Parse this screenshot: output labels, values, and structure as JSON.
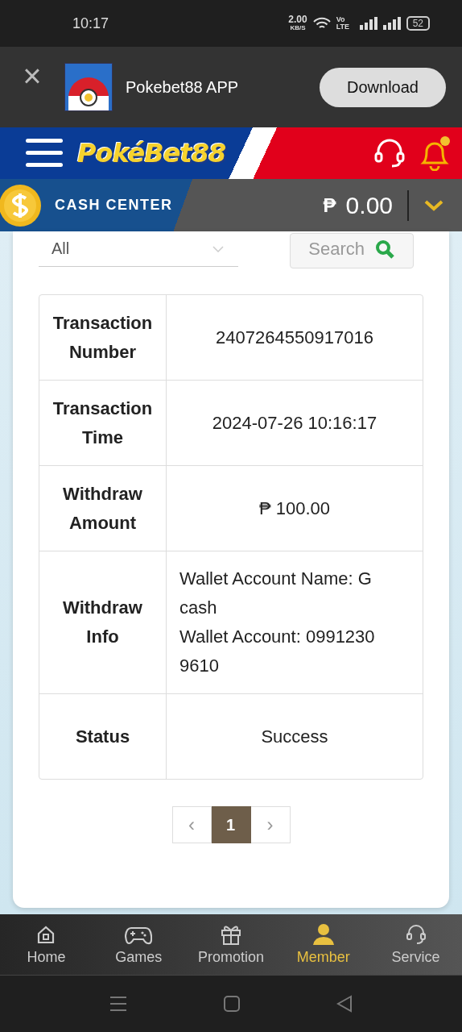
{
  "status_bar": {
    "time": "10:17",
    "speed": "2.00",
    "speed_unit": "KB/S",
    "network": "Vo LTE",
    "battery": "52"
  },
  "app_banner": {
    "close": "×",
    "title": "Pokebet88 APP",
    "button": "Download"
  },
  "header": {
    "logo": "PokéBet88",
    "notification": true
  },
  "cash_center": {
    "label": "CASH CENTER",
    "currency": "₱",
    "balance": "0.00"
  },
  "filter": {
    "value": "All",
    "search_button": "Search"
  },
  "details": [
    {
      "label": "Transaction Number",
      "value": "2407264550917016"
    },
    {
      "label": "Transaction Time",
      "value": "2024-07-26 10:16:17"
    },
    {
      "label": "Withdraw Amount",
      "value": "₱ 100.00"
    },
    {
      "label": "Withdraw Info",
      "value": "Wallet Account Name: G cash\nWallet Account: 0991230 9610"
    },
    {
      "label": "Status",
      "value": "Success"
    }
  ],
  "pagination": {
    "prev": "‹",
    "next": "›",
    "pages": [
      {
        "label": "1",
        "selected": true
      }
    ]
  },
  "bottom_nav": [
    {
      "kind": "home",
      "label": "Home",
      "selected": false
    },
    {
      "kind": "games",
      "label": "Games",
      "selected": false
    },
    {
      "kind": "promotion",
      "label": "Promotion",
      "selected": false
    },
    {
      "kind": "member",
      "label": "Member",
      "selected": true
    },
    {
      "kind": "service",
      "label": "Service",
      "selected": false
    }
  ]
}
